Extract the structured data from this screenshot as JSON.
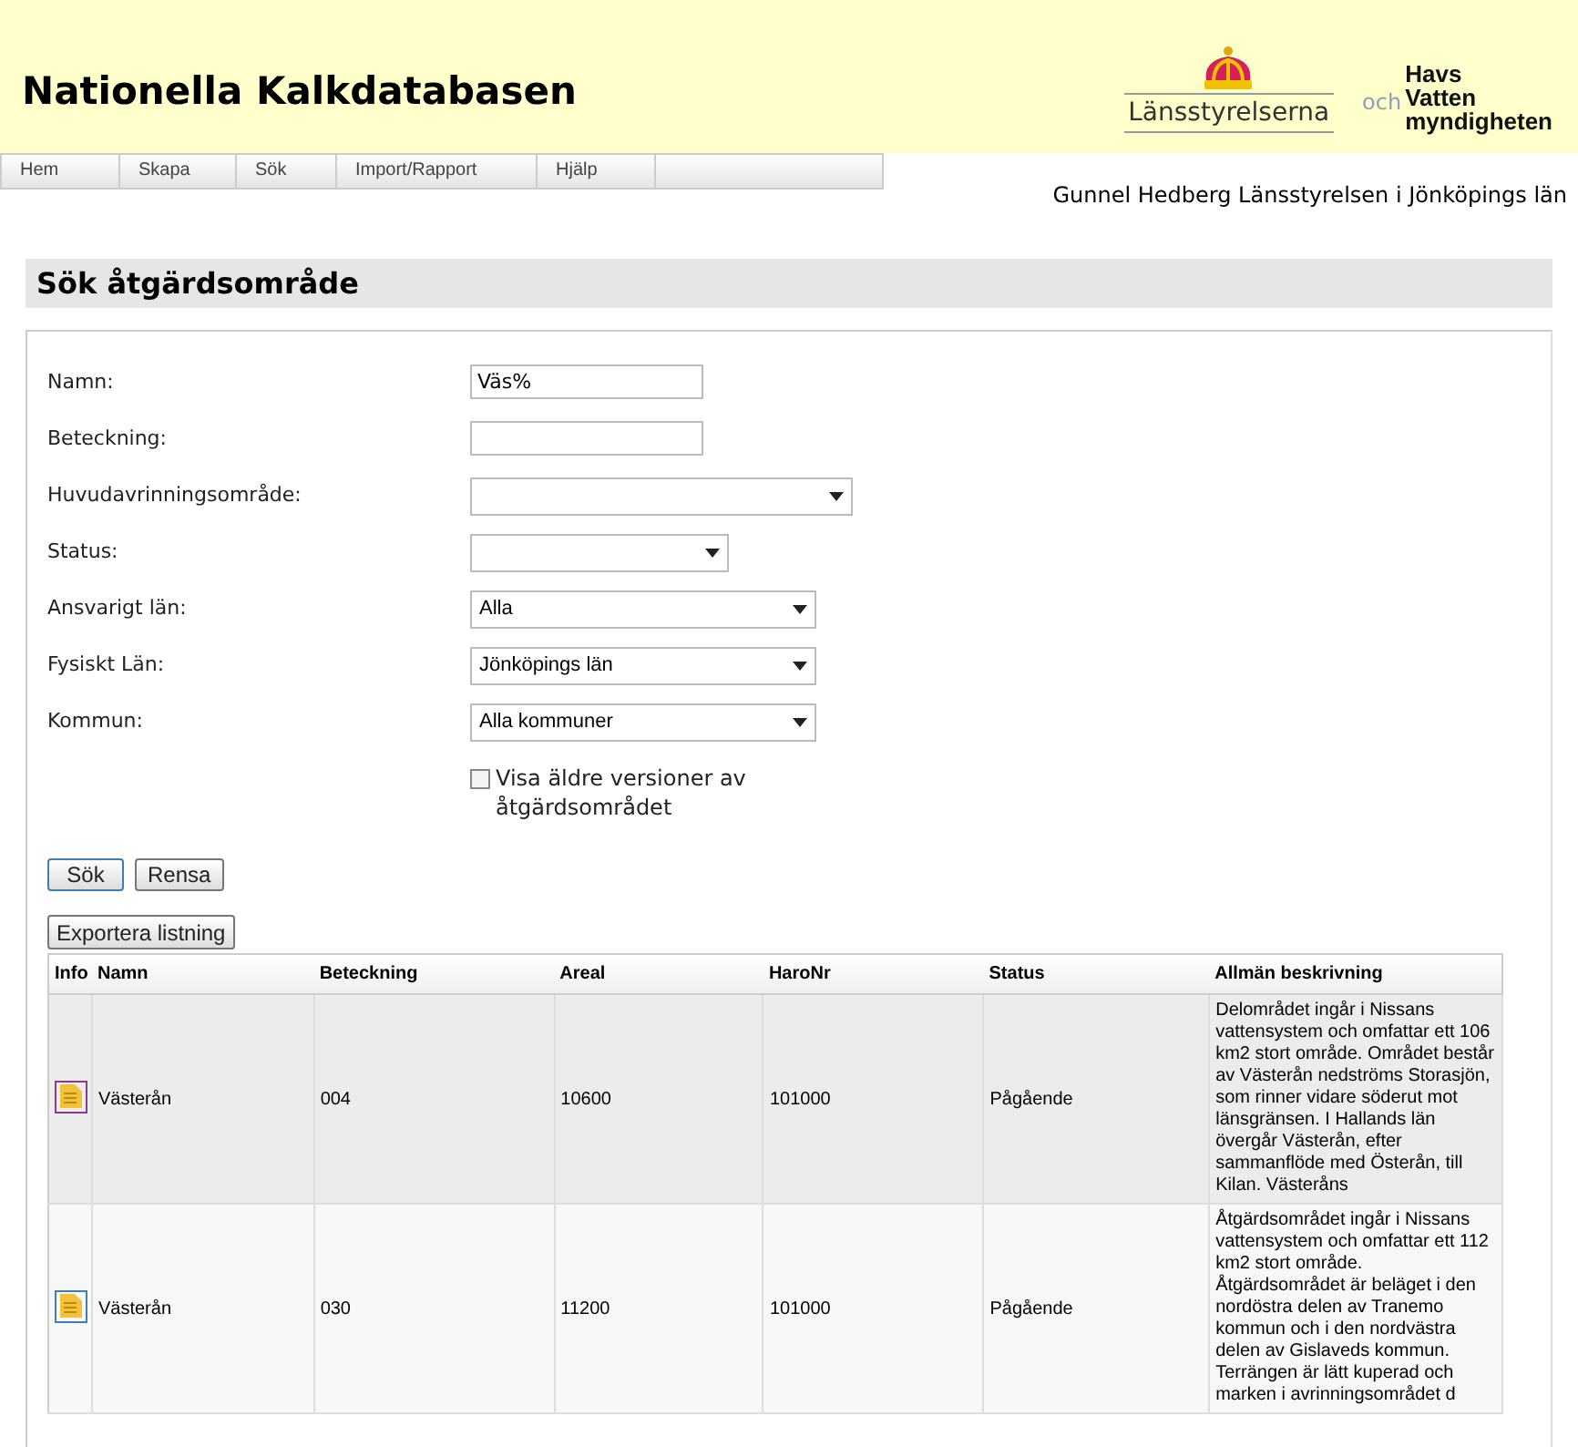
{
  "header": {
    "title": "Nationella Kalkdatabasen",
    "logo_left": "Länsstyrelserna",
    "logo_and": "och",
    "logo_right": [
      "Havs",
      "Vatten",
      "myndigheten"
    ]
  },
  "menu": [
    {
      "label": "Hem"
    },
    {
      "label": "Skapa"
    },
    {
      "label": "Sök"
    },
    {
      "label": "Import/Rapport"
    },
    {
      "label": "Hjälp"
    }
  ],
  "user": "Gunnel Hedberg Länsstyrelsen i Jönköpings län",
  "page_title": "Sök åtgärdsområde",
  "form": [
    {
      "kind": "text",
      "label": "Namn:",
      "value": "Väs%"
    },
    {
      "kind": "text",
      "label": "Beteckning:"
    },
    {
      "kind": "select",
      "label": "Huvudavrinningsområde:"
    },
    {
      "kind": "select",
      "label": "Status:"
    },
    {
      "kind": "select",
      "label": "Ansvarigt län:",
      "value": "Alla"
    },
    {
      "kind": "select",
      "label": "Fysiskt Län:",
      "value": "Jönköpings län"
    },
    {
      "kind": "select",
      "label": "Kommun:",
      "value": "Alla kommuner"
    }
  ],
  "checkbox": {
    "label": "Visa äldre versioner av åtgärdsområdet",
    "checked": false
  },
  "buttons": [
    "Sök",
    "Rensa"
  ],
  "export_button": "Exportera listning",
  "table": {
    "columns": [
      "Info",
      "Namn",
      "Beteckning",
      "Areal",
      "HaroNr",
      "Status",
      "Allmän beskrivning"
    ],
    "rows": [
      {
        "highlighted": true,
        "cells": [
          "",
          "Västerån",
          "004",
          "10600",
          "101000",
          "Pågående",
          "Delområdet ingår i Nissans vattensystem och omfattar ett 106 km2 stort område. Området består av Västerån nedströms Storasjön, som rinner vidare söderut mot länsgränsen. I Hallands län övergår Västerån, efter sammanflöde med Österån, till Kilan. Västeråns"
        ]
      },
      {
        "highlighted": false,
        "cells": [
          "",
          "Västerån",
          "030",
          "11200",
          "101000",
          "Pågående",
          "Åtgärdsområdet ingår i Nissans vattensystem och omfattar ett 112 km2 stort område. Åtgärdsområdet är beläget i den nordöstra delen av Tranemo kommun och i den nordvästra delen av Gislaveds kommun. Terrängen är lätt kuperad och marken i avrinningsområdet d"
        ]
      }
    ]
  }
}
